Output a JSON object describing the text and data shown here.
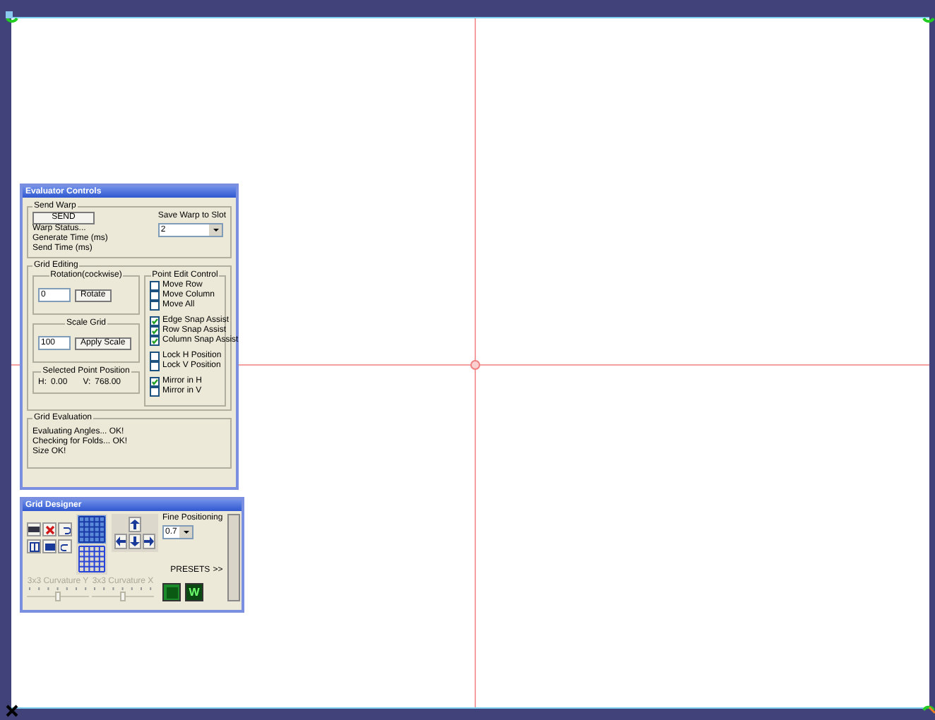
{
  "evaluator": {
    "title": "Evaluator Controls",
    "send_warp": {
      "legend": "Send Warp",
      "send_button": "SEND",
      "status_lines": [
        "Warp Status...",
        "Generate Time (ms)",
        "Send Time (ms)"
      ],
      "slot_label": "Save Warp to Slot",
      "slot_value": "2"
    },
    "grid_editing": {
      "legend": "Grid Editing",
      "rotation": {
        "legend": "Rotation(cockwise)",
        "value": "0",
        "button": "Rotate"
      },
      "scale": {
        "legend": "Scale Grid",
        "value": "100",
        "button": "Apply Scale"
      },
      "selected_point": {
        "legend": "Selected Point Position",
        "h_label": "H:",
        "h": "0.00",
        "v_label": "V:",
        "v": "768.00"
      },
      "point_edit": {
        "legend": "Point Edit Control",
        "groups": [
          [
            {
              "label": "Move Row",
              "checked": false
            },
            {
              "label": "Move Column",
              "checked": false
            },
            {
              "label": "Move All",
              "checked": false
            }
          ],
          [
            {
              "label": "Edge Snap Assist",
              "checked": true
            },
            {
              "label": "Row Snap Assist",
              "checked": true
            },
            {
              "label": "Column Snap Assist",
              "checked": true
            }
          ],
          [
            {
              "label": "Lock H Position",
              "checked": false
            },
            {
              "label": "Lock V Position",
              "checked": false
            }
          ],
          [
            {
              "label": "Mirror in H",
              "checked": true
            },
            {
              "label": "Mirror in V",
              "checked": false
            }
          ]
        ]
      }
    },
    "grid_evaluation": {
      "legend": "Grid Evaluation",
      "lines": [
        "Evaluating Angles... OK!",
        "Checking for Folds... OK!",
        "Size OK!"
      ]
    }
  },
  "designer": {
    "title": "Grid Designer",
    "fine_label": "Fine Positioning",
    "fine_value": "0.7",
    "presets": "PRESETS",
    "more": ">>",
    "sliders": [
      {
        "label": "3x3 Curvature Y",
        "level": 0.5,
        "disabled": true
      },
      {
        "label": "3x3 Curvature X",
        "level": 0.5,
        "disabled": true
      }
    ],
    "w_button": "W"
  }
}
